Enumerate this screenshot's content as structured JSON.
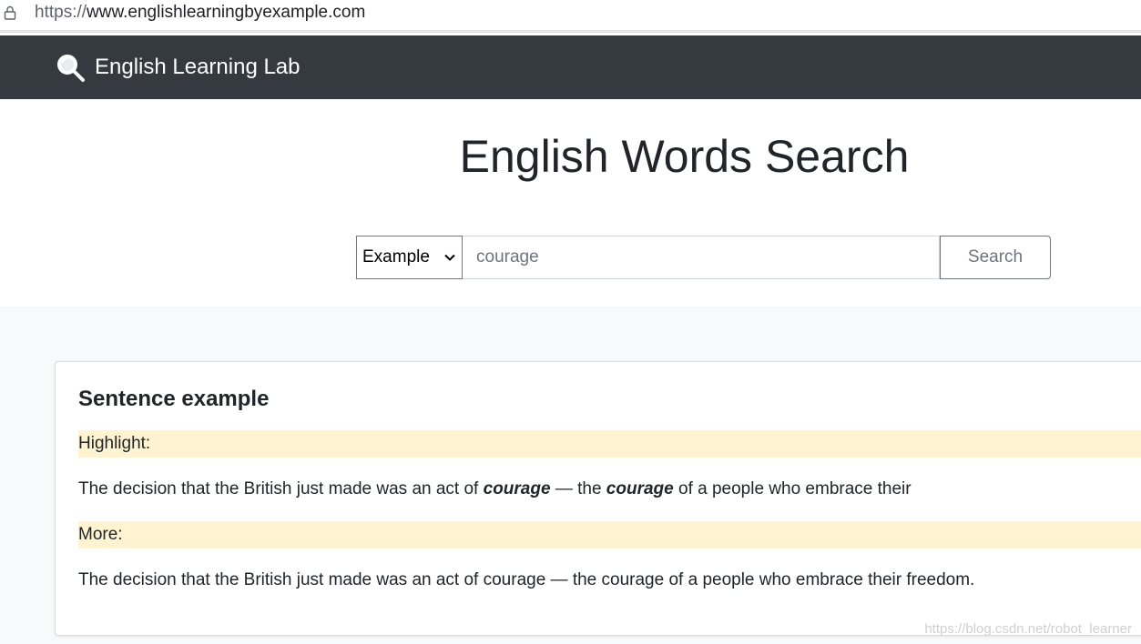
{
  "browser": {
    "url_scheme": "https://",
    "url_host": "www.englishlearningbyexample.com"
  },
  "navbar": {
    "brand_icon": "magnifier-icon",
    "brand": "English Learning Lab"
  },
  "hero": {
    "title": "English Words Search"
  },
  "search": {
    "mode_selected": "Example",
    "query_value": "courage",
    "button_label": "Search"
  },
  "card": {
    "title": "Sentence example",
    "highlight_label": "Highlight:",
    "highlight_parts": {
      "p1": "The decision that the British just made was an act of ",
      "k1": "courage",
      "p2": " — the ",
      "k2": "courage",
      "p3": " of a people who embrace their"
    },
    "more_label": "More:",
    "more_sentence": "The decision that the British just made was an act of courage — the courage of a people who embrace their freedom."
  },
  "watermark": "https://blog.csdn.net/robot_learner",
  "colors": {
    "navbar_bg": "#343a40",
    "highlight_band": "#fff3d1",
    "results_bg": "#f8f9fa"
  }
}
